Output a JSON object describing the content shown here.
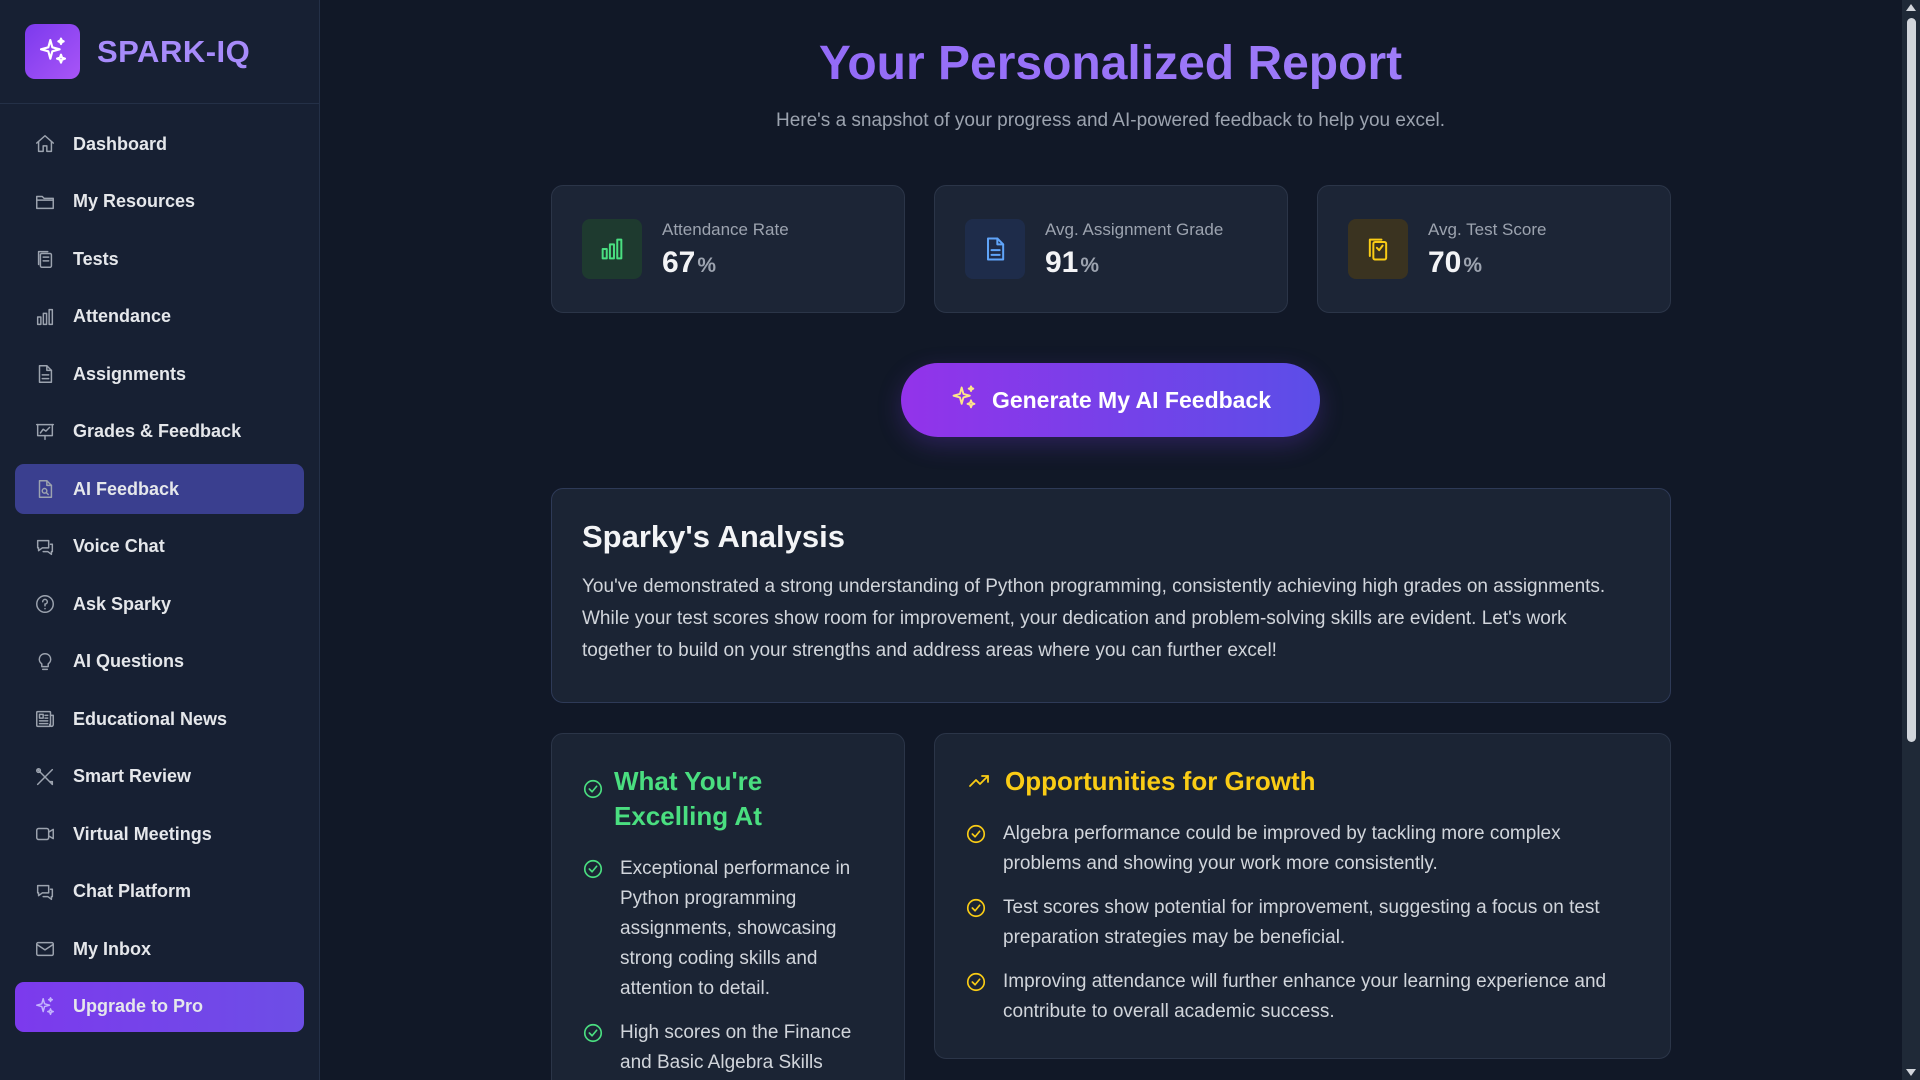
{
  "brand": {
    "name": "SPARK-IQ",
    "logo_icon": "sparkles-icon"
  },
  "sidebar": {
    "items": [
      {
        "label": "Dashboard",
        "icon": "home-icon"
      },
      {
        "label": "My Resources",
        "icon": "folder-icon"
      },
      {
        "label": "Tests",
        "icon": "clipboard-icon"
      },
      {
        "label": "Attendance",
        "icon": "bar-chart-icon"
      },
      {
        "label": "Assignments",
        "icon": "document-icon"
      },
      {
        "label": "Grades & Feedback",
        "icon": "presentation-chart-icon"
      },
      {
        "label": "AI Feedback",
        "icon": "document-search-icon",
        "active": true
      },
      {
        "label": "Voice Chat",
        "icon": "chat-bubbles-icon"
      },
      {
        "label": "Ask Sparky",
        "icon": "question-circle-icon"
      },
      {
        "label": "AI Questions",
        "icon": "lightbulb-icon"
      },
      {
        "label": "Educational News",
        "icon": "newspaper-icon"
      },
      {
        "label": "Smart Review",
        "icon": "tools-icon"
      },
      {
        "label": "Virtual Meetings",
        "icon": "video-camera-icon"
      },
      {
        "label": "Chat Platform",
        "icon": "chat-bubbles-icon"
      },
      {
        "label": "My Inbox",
        "icon": "mail-icon"
      }
    ],
    "upgrade": {
      "label": "Upgrade to Pro",
      "icon": "sparkles-icon"
    }
  },
  "header": {
    "title": "Your Personalized Report",
    "subtitle": "Here's a snapshot of your progress and AI-powered feedback to help you excel."
  },
  "stats": [
    {
      "label": "Attendance Rate",
      "value": "67",
      "unit": "%",
      "icon": "bar-chart-icon",
      "color": "#4ade80"
    },
    {
      "label": "Avg. Assignment Grade",
      "value": "91",
      "unit": "%",
      "icon": "document-icon",
      "color": "#60a5fa"
    },
    {
      "label": "Avg. Test Score",
      "value": "70",
      "unit": "%",
      "icon": "clipboard-icon",
      "color": "#facc15"
    }
  ],
  "generate_button": {
    "label": "Generate My AI Feedback",
    "icon": "sparkles-icon"
  },
  "analysis": {
    "title": "Sparky's Analysis",
    "body": "You've demonstrated a strong understanding of Python programming, consistently achieving high grades on assignments. While your test scores show room for improvement, your dedication and problem-solving skills are evident. Let's work together to build on your strengths and address areas where you can further excel!"
  },
  "excelling": {
    "title": "What You're Excelling At",
    "items": [
      "Exceptional performance in Python programming assignments, showcasing strong coding skills and attention to detail.",
      "High scores on the Finance and Basic Algebra Skills"
    ]
  },
  "growth": {
    "title": "Opportunities for Growth",
    "items": [
      "Algebra performance could be improved by tackling more complex problems and showing your work more consistently.",
      "Test scores show potential for improvement, suggesting a focus on test preparation strategies may be beneficial.",
      "Improving attendance will further enhance your learning experience and contribute to overall academic success."
    ]
  },
  "colors": {
    "accent": "#8b5cf6",
    "success": "#4ade80",
    "warning": "#facc15",
    "info": "#60a5fa"
  }
}
